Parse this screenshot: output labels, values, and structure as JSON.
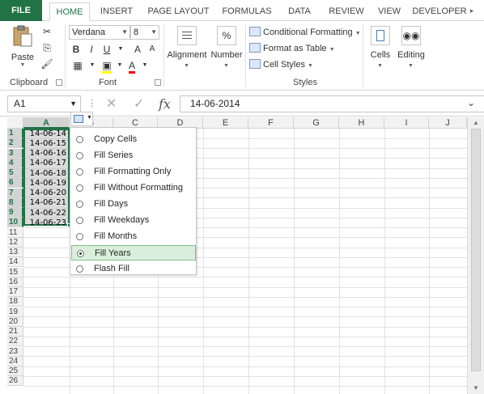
{
  "ribbon_tabs": [
    "FILE",
    "HOME",
    "INSERT",
    "PAGE LAYOUT",
    "FORMULAS",
    "DATA",
    "REVIEW",
    "VIEW",
    "DEVELOPER"
  ],
  "clipboard": {
    "paste_label": "Paste",
    "group_label": "Clipboard"
  },
  "font": {
    "name": "Verdana",
    "size": "8",
    "group_label": "Font",
    "bold": "B",
    "italic": "I",
    "underline": "U",
    "grow": "A",
    "shrink": "A",
    "font_color_glyph": "A"
  },
  "alignment": {
    "label": "Alignment"
  },
  "number": {
    "label": "Number",
    "glyph": "%"
  },
  "styles": {
    "conditional": "Conditional Formatting",
    "format_table": "Format as Table",
    "cell_styles": "Cell Styles",
    "group_label": "Styles"
  },
  "cells": {
    "label": "Cells"
  },
  "editing": {
    "label": "Editing"
  },
  "formula_bar": {
    "name_box": "A1",
    "fx": "fx",
    "value": "14-06-2014"
  },
  "columns": [
    "A",
    "B",
    "C",
    "D",
    "E",
    "F",
    "G",
    "H",
    "I",
    "J"
  ],
  "rows": [
    "1",
    "2",
    "3",
    "4",
    "5",
    "6",
    "7",
    "8",
    "9",
    "10",
    "11",
    "12",
    "13",
    "14",
    "15",
    "16",
    "17",
    "18",
    "19",
    "20",
    "21",
    "22",
    "23",
    "24",
    "25",
    "26"
  ],
  "cells_a": [
    "14-06-14",
    "14-06-15",
    "14-06-16",
    "14-06-17",
    "14-06-18",
    "14-06-19",
    "14-06-20",
    "14-06-21",
    "14-06-22",
    "14-06-23"
  ],
  "autofill_menu": [
    {
      "label": "Copy Cells",
      "selected": false
    },
    {
      "label": "Fill Series",
      "selected": false
    },
    {
      "label": "Fill Formatting Only",
      "selected": false
    },
    {
      "label": "Fill Without Formatting",
      "selected": false
    },
    {
      "label": "Fill Days",
      "selected": false
    },
    {
      "label": "Fill Weekdays",
      "selected": false
    },
    {
      "label": "Fill Months",
      "selected": false
    },
    {
      "label": "Fill Years",
      "selected": true
    },
    {
      "label": "Flash Fill",
      "selected": false
    }
  ],
  "colors": {
    "accent": "#217346",
    "highlight": "#d9efdc"
  }
}
